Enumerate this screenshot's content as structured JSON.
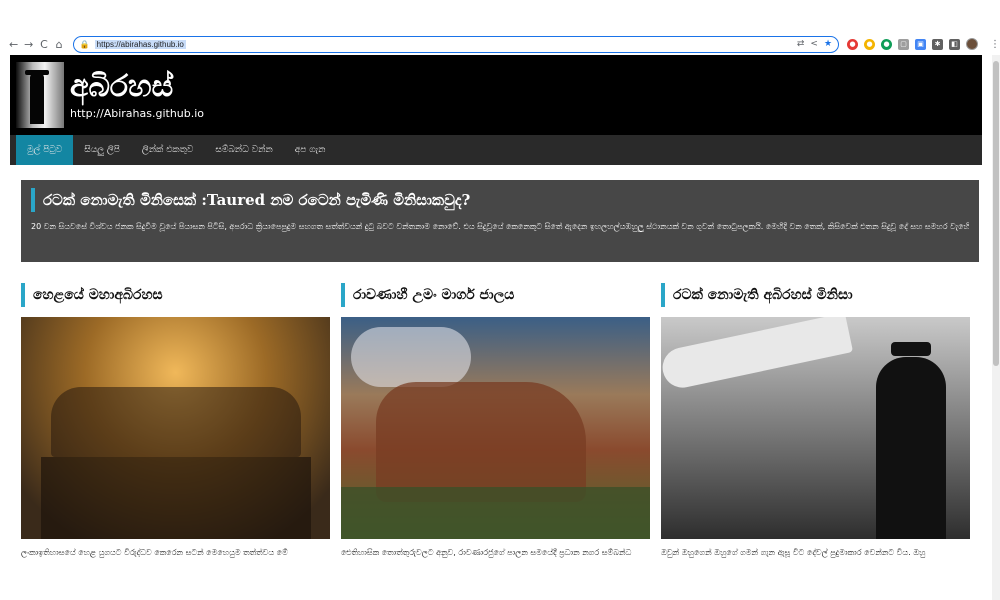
{
  "browser": {
    "url": "https://abirahas.github.io",
    "nav": {
      "back": "←",
      "forward": "→",
      "reload": "C",
      "home": "⌂"
    }
  },
  "site": {
    "title": "අබිරහස්",
    "url": "http://Abirahas.github.io"
  },
  "nav": {
    "items": [
      {
        "label": "මුල් පිටුව",
        "active": true
      },
      {
        "label": "සියලු ලිපි",
        "active": false
      },
      {
        "label": "ලින්ක් එකතුව",
        "active": false
      },
      {
        "label": "සම්බන්ධ වන්න",
        "active": false
      },
      {
        "label": "අප ගැන",
        "active": false
      }
    ]
  },
  "featured": {
    "title": "රටක් නොමැති මිනිසෙක් :Taured නම රටෙන් පැමිණි මිනිසාකවුද?",
    "description": "20 වන සියවසේ විශ්වය ජනක සිදුවීම වූයේ පියාසන පිටිසි, අපරාධ ක්‍රියාපෙපුදුම සහගත සත්ත්වයන් දුටු බවට වන්තනාම නොවේ. එය සිදුවූයේ කෙනෙකුට සිතේ ඇදෙන ඉහලහල්යඹහුලු ස්ථානයක් වන ගුවන් තොටුපලකයි. මෙහිදි වන තෙක්, කිසිවෙක් එතන සිදුවූ දේ සහ සමහර වැහෙින සංවත්සයෙක් නූතන ලෝකය විසින් අමතක කළ අමු මහාලෙඹිරිකලික හදවත වෙන බව දන සිටියේ නැ"
  },
  "cards": [
    {
      "title": "හෙළයේ මහාඅබිරහස",
      "text": "ලංකාඉතිහාසයේ හෙළ යුගයට විරුද්ධව කෙරෙන සටන් මෙහෙයුම තත්ත්වය මේ"
    },
    {
      "title": "රාවණාහී උමං මාර්ග ජාලය",
      "text": "ඓතිහාසික තොත්තුරුවලට අනුව, රාවණාරජුගේ පාලන සමයේදී ප්‍රධාන නගර සම්බන්ධ"
    },
    {
      "title": "රටක් නොමැති අබිරහස් මිනිසා",
      "text": "ඔවුන් ඔහුගෙන් ඔහුගේ ගමන් ගැන ඇසූ විට දේවල් පුදුමාකාර වෙන්නට විය. ඔහු"
    }
  ],
  "colors": {
    "accent": "#2aa6c8",
    "nav_active": "#1386a2",
    "header_bg": "#000000",
    "featured_bg": "#474747"
  }
}
